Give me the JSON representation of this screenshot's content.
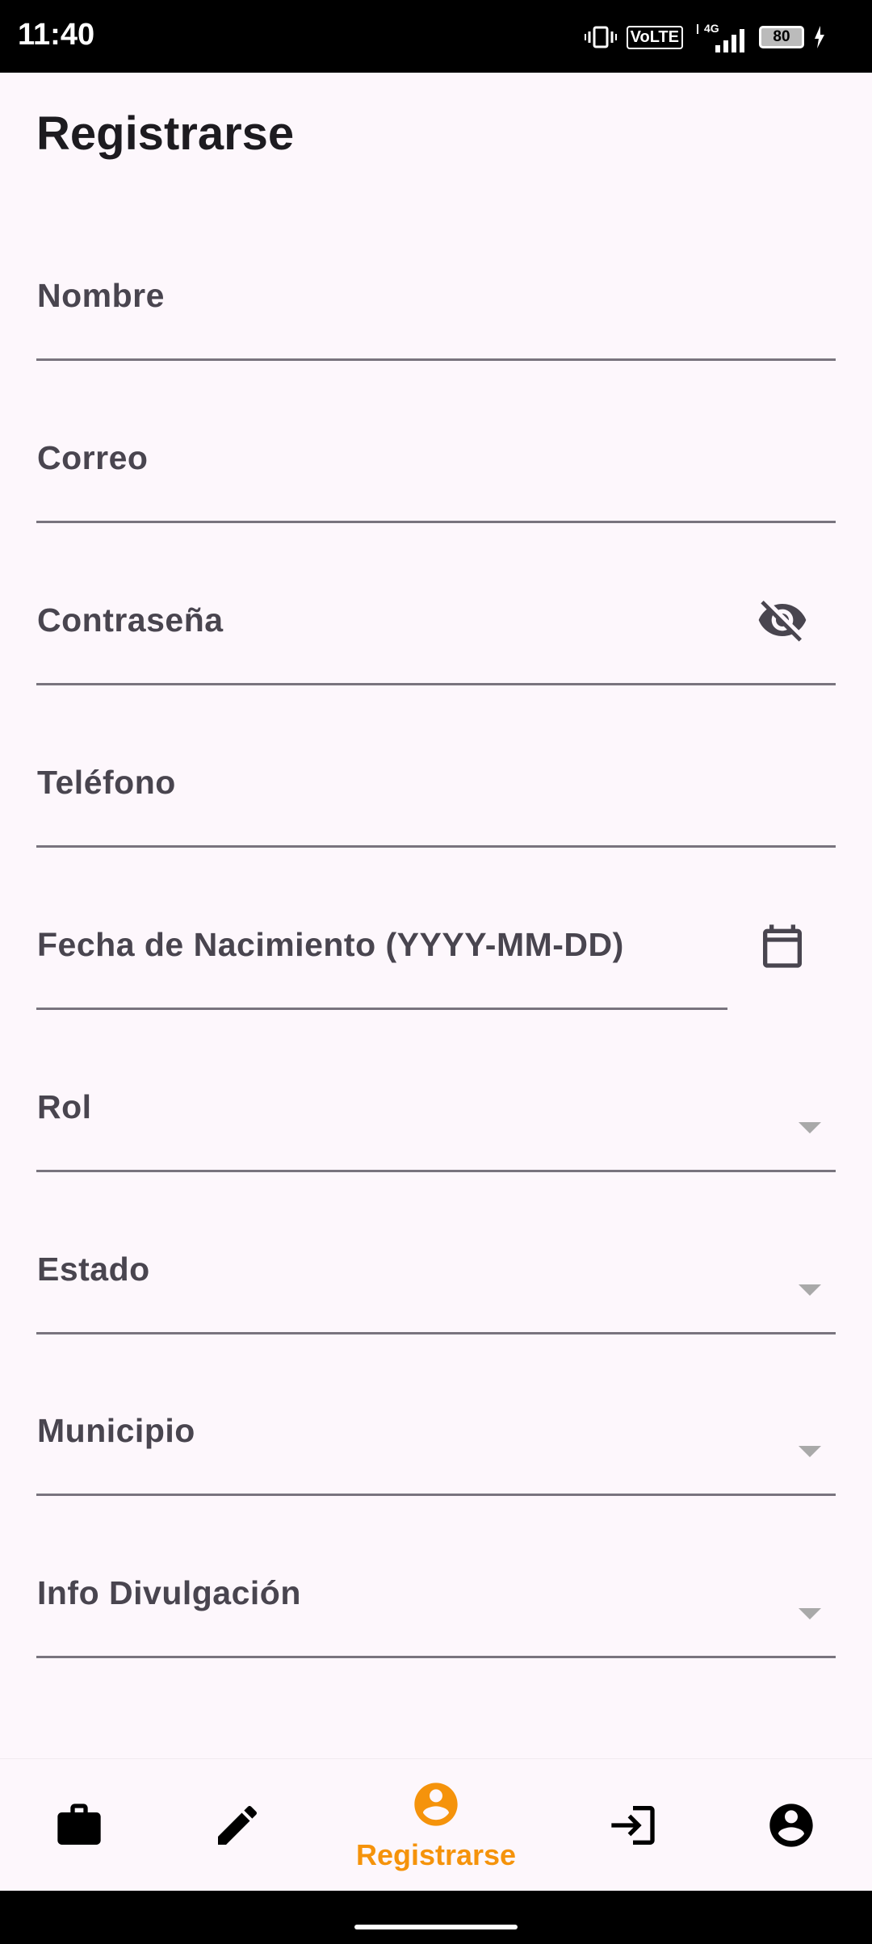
{
  "status_bar": {
    "time": "11:40",
    "volte": "VoLTE",
    "network": "4G",
    "battery": "80"
  },
  "page": {
    "title": "Registrarse"
  },
  "form": {
    "nombre_label": "Nombre",
    "correo_label": "Correo",
    "password_label": "Contraseña",
    "telefono_label": "Teléfono",
    "fecha_label": "Fecha de Nacimiento (YYYY-MM-DD)",
    "rol_label": "Rol",
    "estado_label": "Estado",
    "municipio_label": "Municipio",
    "info_label": "Info Divulgación"
  },
  "bottom_nav": {
    "active_color": "#f5930b",
    "items": [
      {
        "icon": "briefcase-icon"
      },
      {
        "icon": "pencil-icon"
      },
      {
        "icon": "account-circle-icon",
        "label": "Registrarse"
      },
      {
        "icon": "login-icon"
      },
      {
        "icon": "account-circle-icon"
      }
    ]
  }
}
